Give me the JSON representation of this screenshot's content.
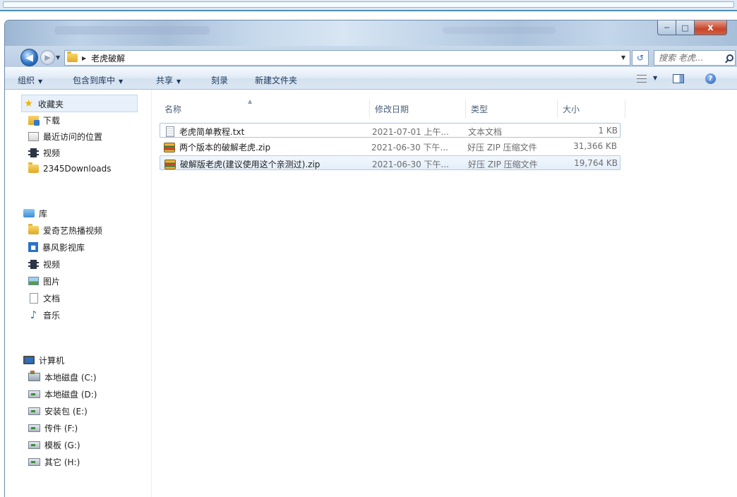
{
  "window": {
    "controls": {
      "minimize": "─",
      "maximize": "□",
      "close": "x"
    }
  },
  "address_bar": {
    "path": "老虎破解",
    "search_placeholder": "搜索 老虎..."
  },
  "toolbar": {
    "organize": "组织",
    "include_in_library": "包含到库中",
    "share": "共享",
    "burn": "刻录",
    "new_folder": "新建文件夹"
  },
  "nav_pane": {
    "favorites": {
      "label": "收藏夹",
      "items": [
        {
          "label": "下载",
          "icon": "download-folder-icon"
        },
        {
          "label": "最近访问的位置",
          "icon": "recent-places-icon"
        },
        {
          "label": "视频",
          "icon": "video-icon"
        },
        {
          "label": "2345Downloads",
          "icon": "folder-icon"
        }
      ]
    },
    "libraries": {
      "label": "库",
      "items": [
        {
          "label": "爱奇艺热播视频",
          "icon": "folder-icon"
        },
        {
          "label": "暴风影视库",
          "icon": "storm-player-icon"
        },
        {
          "label": "视频",
          "icon": "video-icon"
        },
        {
          "label": "图片",
          "icon": "pictures-icon"
        },
        {
          "label": "文档",
          "icon": "document-icon"
        },
        {
          "label": "音乐",
          "icon": "music-icon"
        }
      ]
    },
    "computer": {
      "label": "计算机",
      "items": [
        {
          "label": "本地磁盘 (C:)",
          "icon": "system-drive-icon"
        },
        {
          "label": "本地磁盘 (D:)",
          "icon": "drive-icon"
        },
        {
          "label": "安装包 (E:)",
          "icon": "drive-icon"
        },
        {
          "label": "传件 (F:)",
          "icon": "drive-icon"
        },
        {
          "label": "模板 (G:)",
          "icon": "drive-icon"
        },
        {
          "label": "其它 (H:)",
          "icon": "drive-icon"
        }
      ]
    }
  },
  "file_list": {
    "columns": {
      "name": "名称",
      "date": "修改日期",
      "type": "类型",
      "size": "大小"
    },
    "rows": [
      {
        "name": "老虎简单教程.txt",
        "date": "2021-07-01 上午...",
        "type": "文本文档",
        "size": "1 KB",
        "icon": "text-file-icon"
      },
      {
        "name": "两个版本的破解老虎.zip",
        "date": "2021-06-30 下午...",
        "type": "好压 ZIP 压缩文件",
        "size": "31,366 KB",
        "icon": "zip-file-icon"
      },
      {
        "name": "破解版老虎(建议使用这个亲测过).zip",
        "date": "2021-06-30 下午...",
        "type": "好压 ZIP 压缩文件",
        "size": "19,764 KB",
        "icon": "zip-file-icon"
      }
    ]
  }
}
